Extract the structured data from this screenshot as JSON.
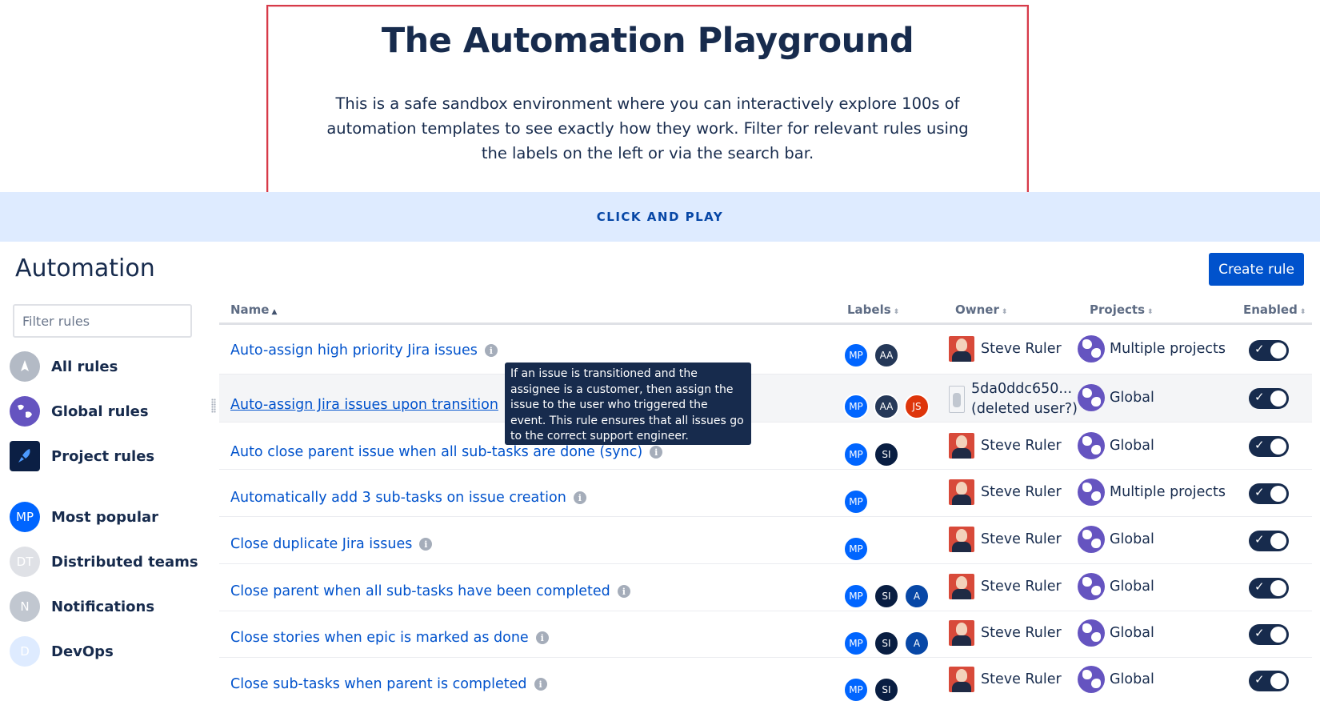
{
  "hero": {
    "title": "The Automation Playground",
    "description": "This is a safe sandbox environment where you can interactively explore 100s of automation templates to see exactly how they work. Filter for relevant rules using the labels on the left or via the search bar."
  },
  "banner": {
    "text": "CLICK AND PLAY"
  },
  "sidebar": {
    "title": "Automation",
    "filter_placeholder": "Filter rules",
    "items": [
      {
        "label": "All rules",
        "icon": "rocket-icon",
        "color": "#b3bac5"
      },
      {
        "label": "Global rules",
        "icon": "globe-icon",
        "color": "#6554c0"
      },
      {
        "label": "Project rules",
        "icon": "rocket-icon",
        "color": "#0b1f44"
      },
      {
        "label": "Most popular",
        "badge": "MP",
        "color": "#0065ff"
      },
      {
        "label": "Distributed teams",
        "badge": "DT",
        "color": "#dfe1e6"
      },
      {
        "label": "Notifications",
        "badge": "N",
        "color": "#c1c7d0"
      },
      {
        "label": "DevOps",
        "badge": "D",
        "color": "#deebff"
      }
    ]
  },
  "toolbar": {
    "create_label": "Create rule"
  },
  "table": {
    "columns": {
      "name": "Name",
      "labels": "Labels",
      "owner": "Owner",
      "projects": "Projects",
      "enabled": "Enabled"
    },
    "rows": [
      {
        "name": "Auto-assign high priority Jira issues",
        "labels": [
          "MP",
          "AA"
        ],
        "owner": "Steve Ruler",
        "project": "Multiple projects",
        "enabled": true
      },
      {
        "name": "Auto-assign Jira issues upon transition",
        "labels": [
          "MP",
          "AA",
          "JS"
        ],
        "owner_line1": "5da0ddc650...",
        "owner_line2": "(deleted user?)",
        "project": "Global",
        "enabled": true
      },
      {
        "name": "Auto close parent issue when all sub-tasks are done (sync)",
        "labels": [
          "MP",
          "SI"
        ],
        "owner": "Steve Ruler",
        "project": "Global",
        "enabled": true
      },
      {
        "name": "Automatically add 3 sub-tasks on issue creation",
        "labels": [
          "MP"
        ],
        "owner": "Steve Ruler",
        "project": "Multiple projects",
        "enabled": true
      },
      {
        "name": "Close duplicate Jira issues",
        "labels": [
          "MP"
        ],
        "owner": "Steve Ruler",
        "project": "Global",
        "enabled": true
      },
      {
        "name": "Close parent when all sub-tasks have been completed",
        "labels": [
          "MP",
          "SI",
          "A"
        ],
        "owner": "Steve Ruler",
        "project": "Global",
        "enabled": true
      },
      {
        "name": "Close stories when epic is marked as done",
        "labels": [
          "MP",
          "SI",
          "A"
        ],
        "owner": "Steve Ruler",
        "project": "Global",
        "enabled": true
      },
      {
        "name": "Close sub-tasks when parent is completed",
        "labels": [
          "MP",
          "SI"
        ],
        "owner": "Steve Ruler",
        "project": "Global",
        "enabled": true
      }
    ]
  },
  "tooltip": {
    "text": "If an issue is transitioned and the assignee is a customer, then assign the issue to the user who triggered the event. This rule ensures that all issues go to the correct support engineer."
  },
  "colors": {
    "MP": "#0065ff",
    "AA": "#253858",
    "JS": "#de350b",
    "SI": "#091e42",
    "A": "#0747a6",
    "primary": "#0052cc",
    "banner": "#deebff",
    "hero_border": "#d73a49"
  }
}
